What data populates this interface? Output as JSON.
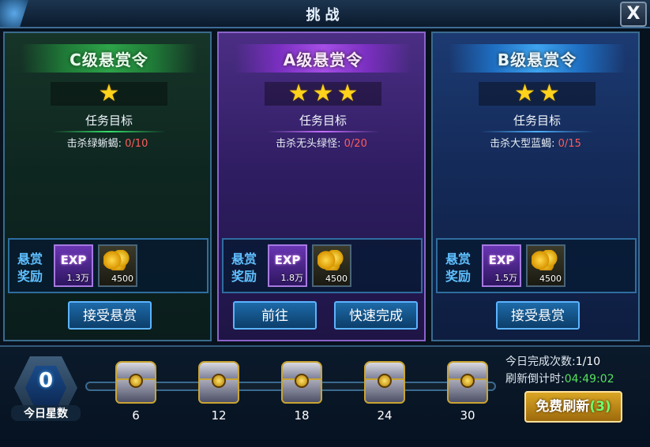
{
  "window": {
    "title": "挑战",
    "close_label": "X"
  },
  "panels": [
    {
      "grade_title": "C级悬赏令",
      "stars": [
        "★"
      ],
      "goal_label": "任务目标",
      "target_text": "击杀绿蜥蝎:",
      "progress": "0/10",
      "reward_label_line1": "悬赏",
      "reward_label_line2": "奖励",
      "exp_label": "EXP",
      "exp_qty": "1.3万",
      "gold_qty": "4500",
      "buttons": [
        "接受悬赏"
      ]
    },
    {
      "grade_title": "A级悬赏令",
      "stars": [
        "★",
        "★",
        "★"
      ],
      "goal_label": "任务目标",
      "target_text": "击杀无头绿怪:",
      "progress": "0/20",
      "reward_label_line1": "悬赏",
      "reward_label_line2": "奖励",
      "exp_label": "EXP",
      "exp_qty": "1.8万",
      "gold_qty": "4500",
      "buttons": [
        "前往",
        "快速完成"
      ]
    },
    {
      "grade_title": "B级悬赏令",
      "stars": [
        "★",
        "★"
      ],
      "goal_label": "任务目标",
      "target_text": "击杀大型蓝蝎:",
      "progress": "0/15",
      "reward_label_line1": "悬赏",
      "reward_label_line2": "奖励",
      "exp_label": "EXP",
      "exp_qty": "1.5万",
      "gold_qty": "4500",
      "buttons": [
        "接受悬赏"
      ]
    }
  ],
  "bottom": {
    "today_stars_value": "0",
    "today_stars_label": "今日星数",
    "chest_milestones": [
      "6",
      "12",
      "18",
      "24",
      "30"
    ],
    "completions_label": "今日完成次数:",
    "completions_value": "1/10",
    "countdown_label": "刷新倒计时:",
    "countdown_value": "04:49:02",
    "refresh_button_label": "免费刷新",
    "refresh_count": "(3)"
  }
}
